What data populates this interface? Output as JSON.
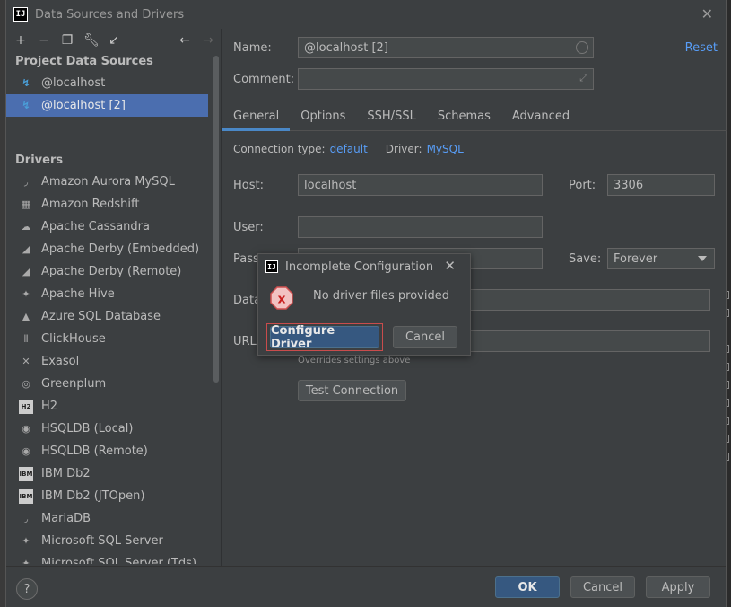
{
  "window": {
    "title": "Data Sources and Drivers",
    "app_icon_text": "IJ"
  },
  "toolbar": {
    "icons": [
      "plus-icon",
      "minus-icon",
      "copy-icon",
      "wrench-icon",
      "import-icon",
      "back-arrow-icon",
      "forward-arrow-icon"
    ]
  },
  "project": {
    "title": "Project Data Sources",
    "items": [
      {
        "label": "@localhost",
        "selected": false
      },
      {
        "label": "@localhost [2]",
        "selected": true
      }
    ]
  },
  "drivers": {
    "title": "Drivers",
    "items": [
      {
        "label": "Amazon Aurora MySQL",
        "icon": "◞"
      },
      {
        "label": "Amazon Redshift",
        "icon": "▦"
      },
      {
        "label": "Apache Cassandra",
        "icon": "☁"
      },
      {
        "label": "Apache Derby (Embedded)",
        "icon": "◢"
      },
      {
        "label": "Apache Derby (Remote)",
        "icon": "◢"
      },
      {
        "label": "Apache Hive",
        "icon": "✦"
      },
      {
        "label": "Azure SQL Database",
        "icon": "▲"
      },
      {
        "label": "ClickHouse",
        "icon": "⦀"
      },
      {
        "label": "Exasol",
        "icon": "✕"
      },
      {
        "label": "Greenplum",
        "icon": "◎"
      },
      {
        "label": "H2",
        "icon": "H2"
      },
      {
        "label": "HSQLDB (Local)",
        "icon": "◉"
      },
      {
        "label": "HSQLDB (Remote)",
        "icon": "◉"
      },
      {
        "label": "IBM Db2",
        "icon": "IBM"
      },
      {
        "label": "IBM Db2 (JTOpen)",
        "icon": "IBM"
      },
      {
        "label": "MariaDB",
        "icon": "◞"
      },
      {
        "label": "Microsoft SQL Server",
        "icon": "✦"
      },
      {
        "label": "Microsoft SQL Server (Tds)",
        "icon": "✦"
      }
    ]
  },
  "form": {
    "name_label": "Name:",
    "name_value": "@localhost [2]",
    "comment_label": "Comment:",
    "comment_value": "",
    "reset_label": "Reset",
    "tabs": [
      "General",
      "Options",
      "SSH/SSL",
      "Schemas",
      "Advanced"
    ],
    "connection_type_label": "Connection type:",
    "connection_type_value": "default",
    "driver_label": "Driver:",
    "driver_value": "MySQL",
    "host_label": "Host:",
    "host_value": "localhost",
    "port_label": "Port:",
    "port_value": "3306",
    "user_label": "User:",
    "user_value": "",
    "password_label": "Password:",
    "save_label": "Save:",
    "save_value": "Forever",
    "database_label": "Database:",
    "url_label": "URL:",
    "overrides_note": "Overrides settings above",
    "test_connection_label": "Test Connection"
  },
  "popup": {
    "title": "Incomplete Configuration",
    "message": "No driver files provided",
    "configure_label": "Configure Driver",
    "cancel_label": "Cancel"
  },
  "footer": {
    "help_label": "?",
    "ok_label": "OK",
    "cancel_label": "Cancel",
    "apply_label": "Apply"
  }
}
